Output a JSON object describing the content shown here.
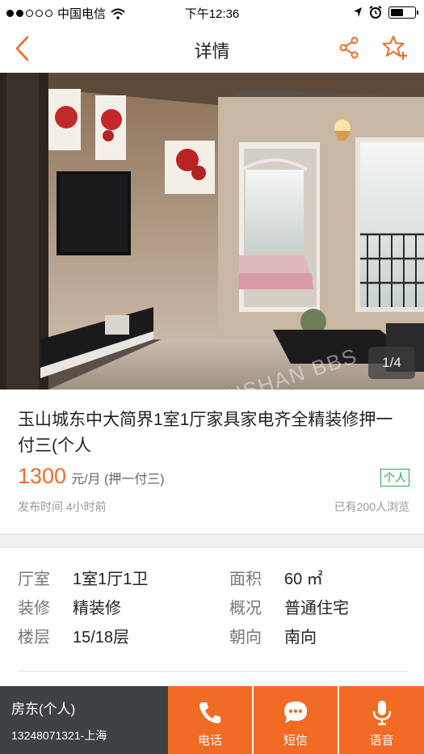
{
  "status_bar": {
    "carrier": "中国电信",
    "time": "下午12:36"
  },
  "nav": {
    "title": "详情",
    "back_icon": "chevron-left-icon",
    "share_icon": "share-icon",
    "favorite_icon": "star-add-icon",
    "accent_color": "#f16b25"
  },
  "gallery": {
    "counter": "1/4",
    "watermark": "昆山论坛 KUNSHAN BBS"
  },
  "listing": {
    "title": "玉山城东中大简界1室1厅家具家电齐全精装修押一付三(个人",
    "price": "1300",
    "price_unit": "元/月 (押一付三)",
    "tag": "个人",
    "published": "发布时间 4小时前",
    "views": "已有200人浏览"
  },
  "details": [
    {
      "k1": "厅室",
      "v1": "1室1厅1卫",
      "k2": "面积",
      "v2": "60 ㎡"
    },
    {
      "k1": "装修",
      "v1": "精装修",
      "k2": "概况",
      "v2": "普通住宅"
    },
    {
      "k1": "楼层",
      "v1": "15/18层",
      "k2": "朝向",
      "v2": "南向"
    }
  ],
  "bottom_bar": {
    "contact_name": "房东(个人)",
    "contact_phone": "13248071321-上海",
    "call_label": "电话",
    "sms_label": "短信",
    "voice_label": "语音"
  }
}
